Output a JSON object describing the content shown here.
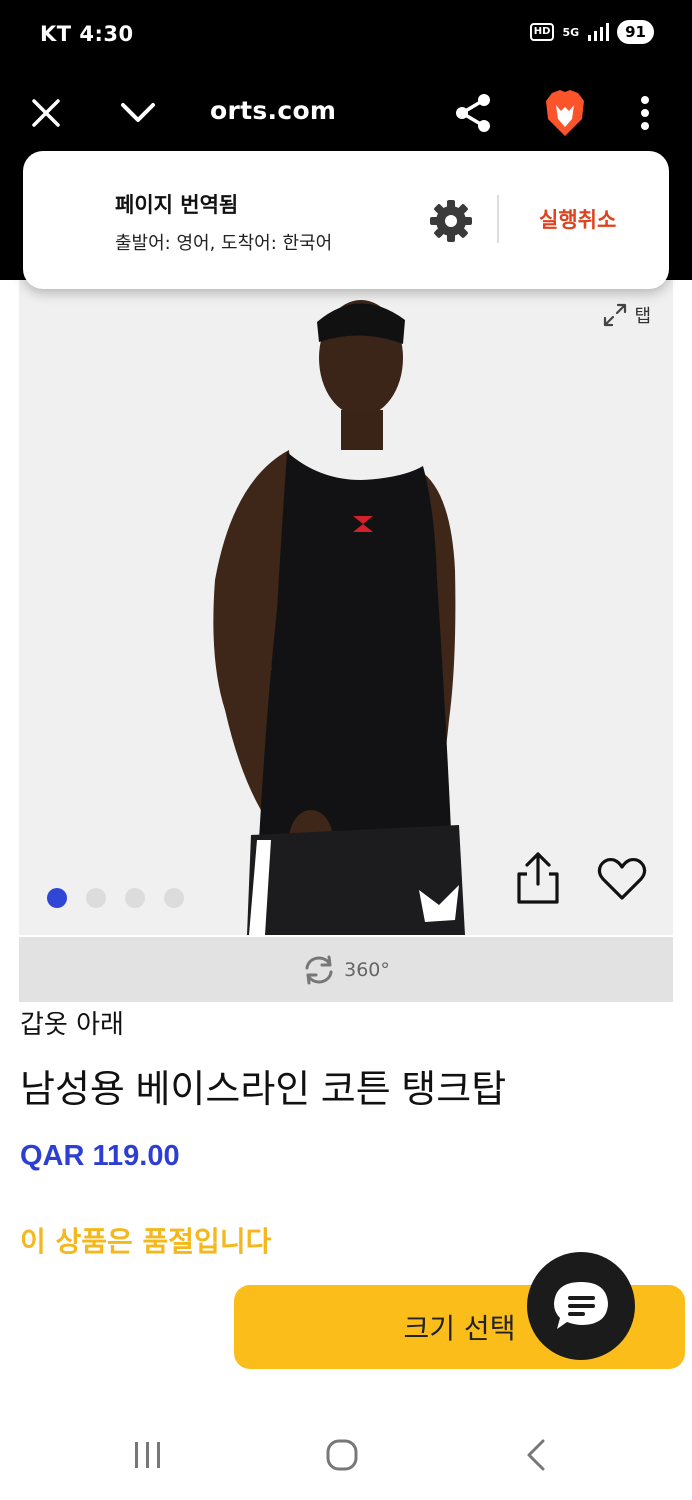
{
  "status_bar": {
    "carrier": "KT 4:30",
    "hd": "HD",
    "network": "5G",
    "battery": "91"
  },
  "browser": {
    "url": "orts.com",
    "icons": [
      "close-icon",
      "chevron-down-icon",
      "share-icon",
      "brave-lion-icon",
      "more-vert-icon"
    ]
  },
  "translate_popup": {
    "title": "페이지 번역됨",
    "subtitle": "출발어: 영어, 도착어: 한국어",
    "undo": "실행취소"
  },
  "gallery": {
    "expand_label": "탭",
    "dot_count": 4,
    "active_dot": 0,
    "view360_label": "360°"
  },
  "product": {
    "category": "갑옷 아래",
    "title": "남성용 베이스라인 코튼 탱크탑",
    "price": "QAR 119.00",
    "sold_out": "이 상품은 품절입니다",
    "size_button": "크기 선택"
  },
  "colors": {
    "price": "#2d3fd2",
    "accent": "#fbbd19",
    "undo": "#e0421e",
    "active_dot": "#2f47d4"
  }
}
